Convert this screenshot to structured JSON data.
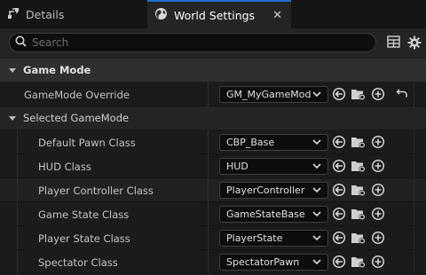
{
  "tabs": [
    {
      "label": "Details",
      "icon": "details-icon",
      "active": false
    },
    {
      "label": "World Settings",
      "icon": "globe-icon",
      "active": true
    }
  ],
  "toolbar": {
    "search_placeholder": "Search",
    "icons": [
      "table-view-icon",
      "settings-gear-icon"
    ]
  },
  "sections": {
    "game_mode": {
      "label": "Game Mode",
      "override_label": "GameMode Override",
      "override_value": "GM_MyGameMod"
    },
    "selected": {
      "label": "Selected GameMode",
      "props": [
        {
          "label": "Default Pawn Class",
          "value": "CBP_Base"
        },
        {
          "label": "HUD Class",
          "value": "HUD"
        },
        {
          "label": "Player Controller Class",
          "value": "PlayerController"
        },
        {
          "label": "Game State Class",
          "value": "GameStateBase"
        },
        {
          "label": "Player State Class",
          "value": "PlayerState"
        },
        {
          "label": "Spectator Class",
          "value": "SpectatorPawn"
        }
      ]
    }
  },
  "colors": {
    "accent": "#1f6fd1",
    "panel": "#242424",
    "field": "#0d0d0d"
  }
}
